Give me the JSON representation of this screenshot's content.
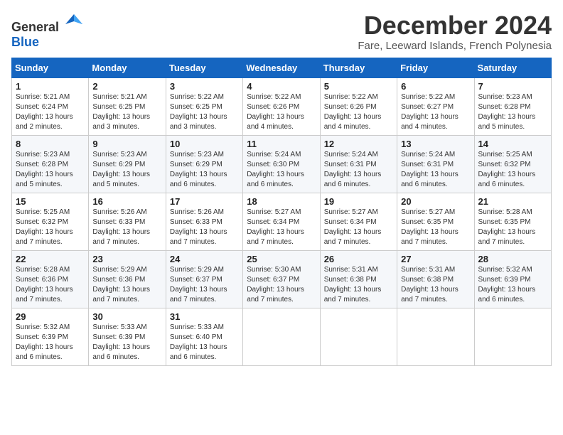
{
  "logo": {
    "general": "General",
    "blue": "Blue"
  },
  "title": "December 2024",
  "subtitle": "Fare, Leeward Islands, French Polynesia",
  "headers": [
    "Sunday",
    "Monday",
    "Tuesday",
    "Wednesday",
    "Thursday",
    "Friday",
    "Saturday"
  ],
  "weeks": [
    [
      {
        "day": "1",
        "detail": "Sunrise: 5:21 AM\nSunset: 6:24 PM\nDaylight: 13 hours\nand 2 minutes."
      },
      {
        "day": "2",
        "detail": "Sunrise: 5:21 AM\nSunset: 6:25 PM\nDaylight: 13 hours\nand 3 minutes."
      },
      {
        "day": "3",
        "detail": "Sunrise: 5:22 AM\nSunset: 6:25 PM\nDaylight: 13 hours\nand 3 minutes."
      },
      {
        "day": "4",
        "detail": "Sunrise: 5:22 AM\nSunset: 6:26 PM\nDaylight: 13 hours\nand 4 minutes."
      },
      {
        "day": "5",
        "detail": "Sunrise: 5:22 AM\nSunset: 6:26 PM\nDaylight: 13 hours\nand 4 minutes."
      },
      {
        "day": "6",
        "detail": "Sunrise: 5:22 AM\nSunset: 6:27 PM\nDaylight: 13 hours\nand 4 minutes."
      },
      {
        "day": "7",
        "detail": "Sunrise: 5:23 AM\nSunset: 6:28 PM\nDaylight: 13 hours\nand 5 minutes."
      }
    ],
    [
      {
        "day": "8",
        "detail": "Sunrise: 5:23 AM\nSunset: 6:28 PM\nDaylight: 13 hours\nand 5 minutes."
      },
      {
        "day": "9",
        "detail": "Sunrise: 5:23 AM\nSunset: 6:29 PM\nDaylight: 13 hours\nand 5 minutes."
      },
      {
        "day": "10",
        "detail": "Sunrise: 5:23 AM\nSunset: 6:29 PM\nDaylight: 13 hours\nand 6 minutes."
      },
      {
        "day": "11",
        "detail": "Sunrise: 5:24 AM\nSunset: 6:30 PM\nDaylight: 13 hours\nand 6 minutes."
      },
      {
        "day": "12",
        "detail": "Sunrise: 5:24 AM\nSunset: 6:31 PM\nDaylight: 13 hours\nand 6 minutes."
      },
      {
        "day": "13",
        "detail": "Sunrise: 5:24 AM\nSunset: 6:31 PM\nDaylight: 13 hours\nand 6 minutes."
      },
      {
        "day": "14",
        "detail": "Sunrise: 5:25 AM\nSunset: 6:32 PM\nDaylight: 13 hours\nand 6 minutes."
      }
    ],
    [
      {
        "day": "15",
        "detail": "Sunrise: 5:25 AM\nSunset: 6:32 PM\nDaylight: 13 hours\nand 7 minutes."
      },
      {
        "day": "16",
        "detail": "Sunrise: 5:26 AM\nSunset: 6:33 PM\nDaylight: 13 hours\nand 7 minutes."
      },
      {
        "day": "17",
        "detail": "Sunrise: 5:26 AM\nSunset: 6:33 PM\nDaylight: 13 hours\nand 7 minutes."
      },
      {
        "day": "18",
        "detail": "Sunrise: 5:27 AM\nSunset: 6:34 PM\nDaylight: 13 hours\nand 7 minutes."
      },
      {
        "day": "19",
        "detail": "Sunrise: 5:27 AM\nSunset: 6:34 PM\nDaylight: 13 hours\nand 7 minutes."
      },
      {
        "day": "20",
        "detail": "Sunrise: 5:27 AM\nSunset: 6:35 PM\nDaylight: 13 hours\nand 7 minutes."
      },
      {
        "day": "21",
        "detail": "Sunrise: 5:28 AM\nSunset: 6:35 PM\nDaylight: 13 hours\nand 7 minutes."
      }
    ],
    [
      {
        "day": "22",
        "detail": "Sunrise: 5:28 AM\nSunset: 6:36 PM\nDaylight: 13 hours\nand 7 minutes."
      },
      {
        "day": "23",
        "detail": "Sunrise: 5:29 AM\nSunset: 6:36 PM\nDaylight: 13 hours\nand 7 minutes."
      },
      {
        "day": "24",
        "detail": "Sunrise: 5:29 AM\nSunset: 6:37 PM\nDaylight: 13 hours\nand 7 minutes."
      },
      {
        "day": "25",
        "detail": "Sunrise: 5:30 AM\nSunset: 6:37 PM\nDaylight: 13 hours\nand 7 minutes."
      },
      {
        "day": "26",
        "detail": "Sunrise: 5:31 AM\nSunset: 6:38 PM\nDaylight: 13 hours\nand 7 minutes."
      },
      {
        "day": "27",
        "detail": "Sunrise: 5:31 AM\nSunset: 6:38 PM\nDaylight: 13 hours\nand 7 minutes."
      },
      {
        "day": "28",
        "detail": "Sunrise: 5:32 AM\nSunset: 6:39 PM\nDaylight: 13 hours\nand 6 minutes."
      }
    ],
    [
      {
        "day": "29",
        "detail": "Sunrise: 5:32 AM\nSunset: 6:39 PM\nDaylight: 13 hours\nand 6 minutes."
      },
      {
        "day": "30",
        "detail": "Sunrise: 5:33 AM\nSunset: 6:39 PM\nDaylight: 13 hours\nand 6 minutes."
      },
      {
        "day": "31",
        "detail": "Sunrise: 5:33 AM\nSunset: 6:40 PM\nDaylight: 13 hours\nand 6 minutes."
      },
      {
        "day": "",
        "detail": ""
      },
      {
        "day": "",
        "detail": ""
      },
      {
        "day": "",
        "detail": ""
      },
      {
        "day": "",
        "detail": ""
      }
    ]
  ]
}
